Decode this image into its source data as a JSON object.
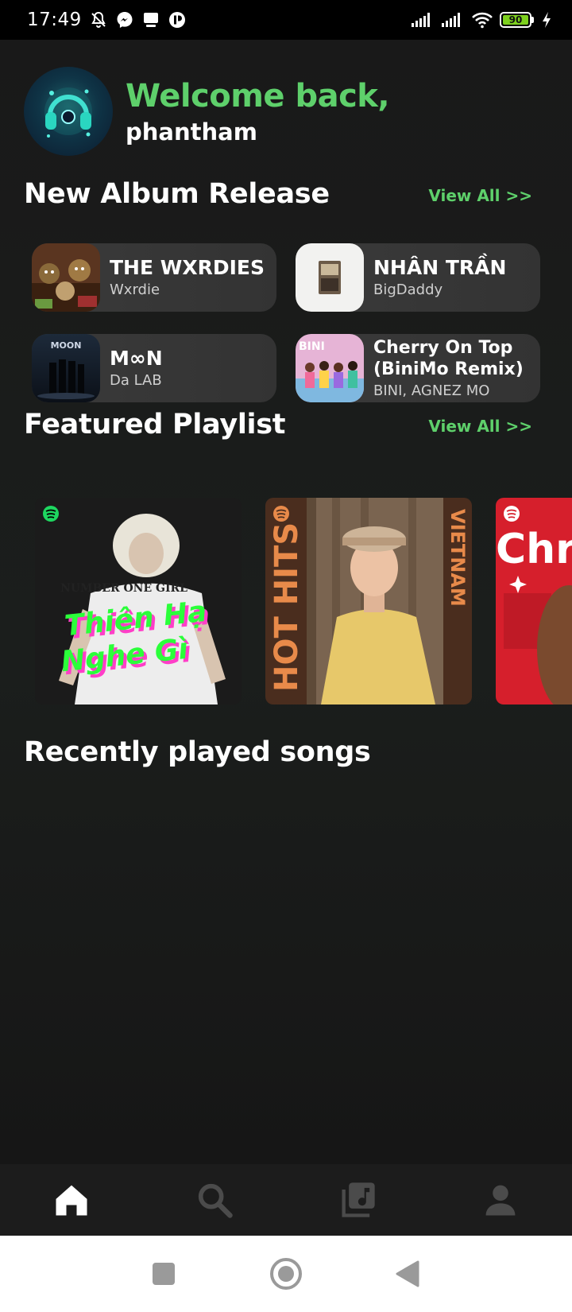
{
  "status_bar": {
    "time": "17:49",
    "battery_level": "90",
    "icons": [
      "bell-off-icon",
      "messenger-icon",
      "cast-icon",
      "app-icon",
      "signal-icon",
      "signal-icon",
      "wifi-icon",
      "battery-icon",
      "charging-icon"
    ]
  },
  "header": {
    "welcome": "Welcome back,",
    "username": "phantham",
    "avatar_icon": "headphones-icon"
  },
  "albums_section": {
    "title": "New Album Release",
    "view_all": "View All >>",
    "albums": [
      {
        "title": "THE WXRDIES",
        "artist": "Wxrdie"
      },
      {
        "title": "NHÂN TRẦN",
        "artist": "BigDaddy"
      },
      {
        "title": "M∞N",
        "artist": "Da LAB"
      },
      {
        "title": "Cherry On Top (BiniMo Remix)",
        "artist": "BINI, AGNEZ MO"
      }
    ]
  },
  "playlists_section": {
    "title": "Featured Playlist",
    "view_all": "View All >>",
    "playlists": [
      {
        "cover_text": "Thiên Hạ Nghe Gì",
        "shirt_text": "NUMBER ONE GIRL",
        "accent": "#2bff3a"
      },
      {
        "cover_text_left": "HOT HITS",
        "cover_text_right": "VIETNAM",
        "accent": "#e88a4a"
      },
      {
        "cover_text": "Chri",
        "accent": "#d61f2c"
      }
    ]
  },
  "recent_section": {
    "title": "Recently played songs"
  },
  "bottom_nav": {
    "items": [
      "home-icon",
      "search-icon",
      "library-icon",
      "profile-icon"
    ],
    "active": "home-icon"
  },
  "colors": {
    "accent_green": "#5ed06b",
    "background": "#161616",
    "card": "#363636"
  }
}
